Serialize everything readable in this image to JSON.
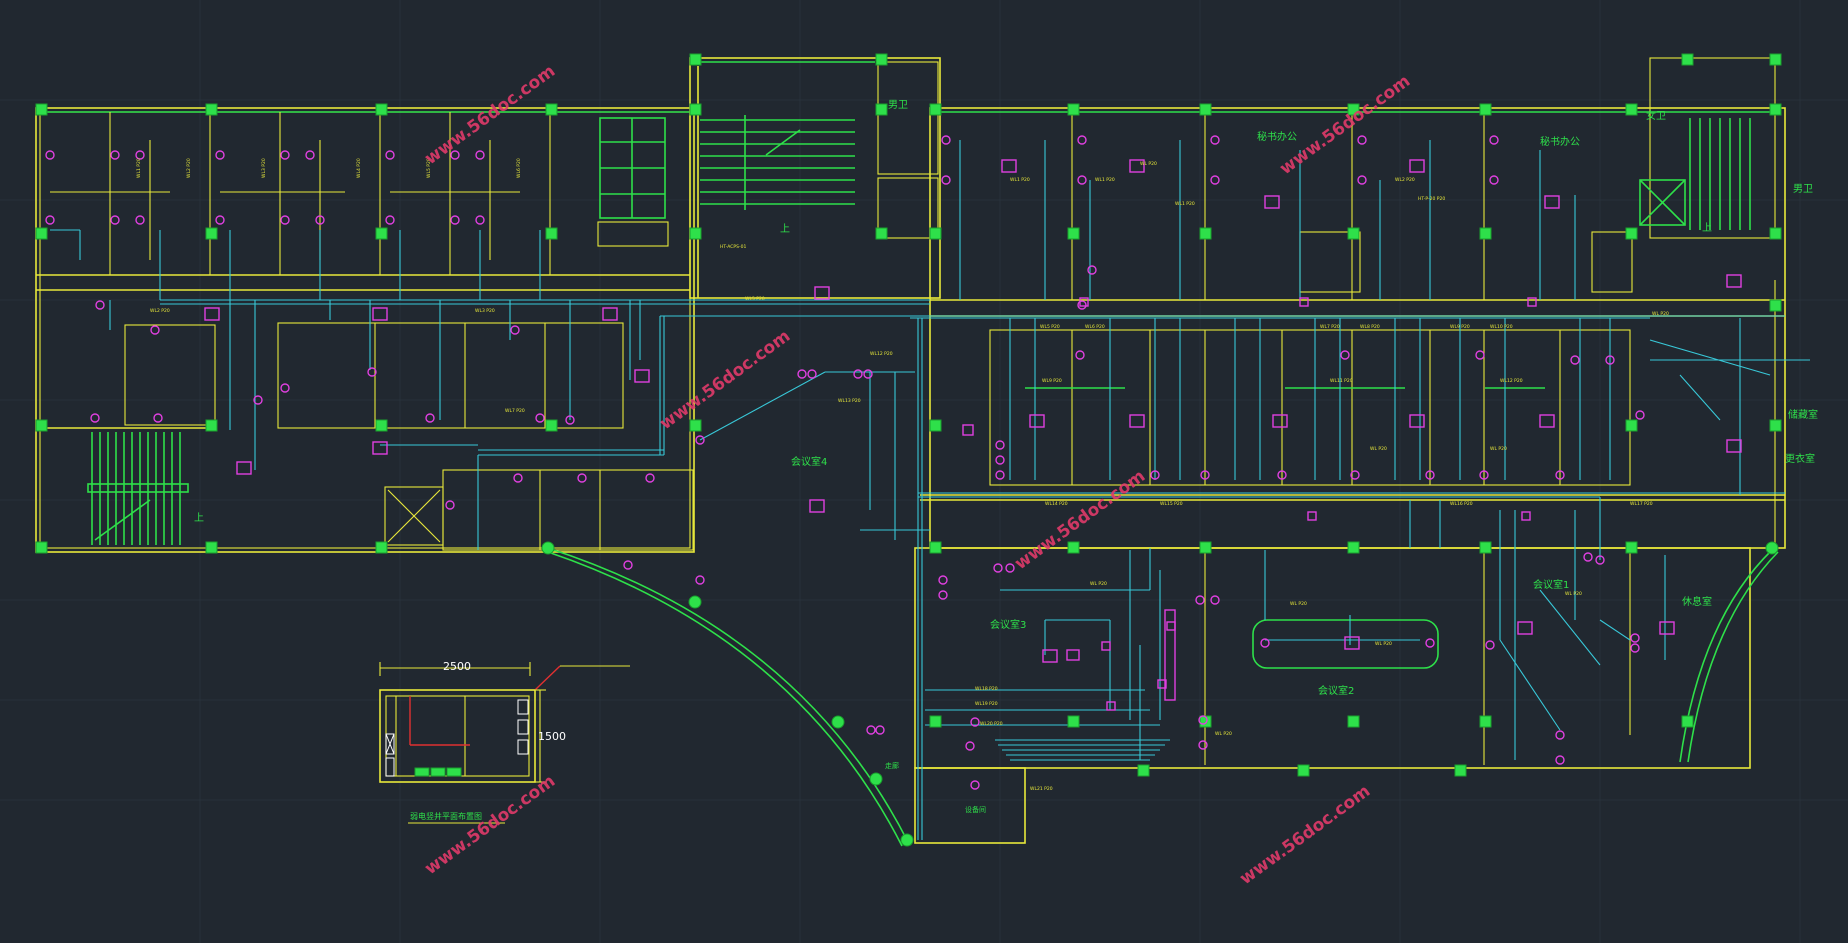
{
  "drawing": {
    "background": "#212830",
    "colors": {
      "wall": "#e8e83a",
      "column": "#2ee04a",
      "wire": "#38c8d8",
      "device": "#e040e0",
      "watermark": "#e03a6a"
    }
  },
  "rooms": {
    "toilet_male_top": "男卫",
    "toilet_female": "女卫",
    "toilet_male_right": "男卫",
    "office_a": "秘书办公",
    "office_b": "秘书办公",
    "meeting_4": "会议室4",
    "meeting_3": "会议室3",
    "meeting_2": "会议室2",
    "meeting_1": "会议室1",
    "rest_room": "休息室",
    "storage": "储藏室",
    "dressing": "更衣室",
    "stair_up_a": "上",
    "stair_up_b": "上",
    "stair_up_c": "上",
    "corridor_note": "走廊",
    "equip": "设备间",
    "detail_title": "弱电竖井平面布置图"
  },
  "dimensions": {
    "width": "2500",
    "height": "1500"
  },
  "watermarks": {
    "text": "www.56doc.com"
  }
}
